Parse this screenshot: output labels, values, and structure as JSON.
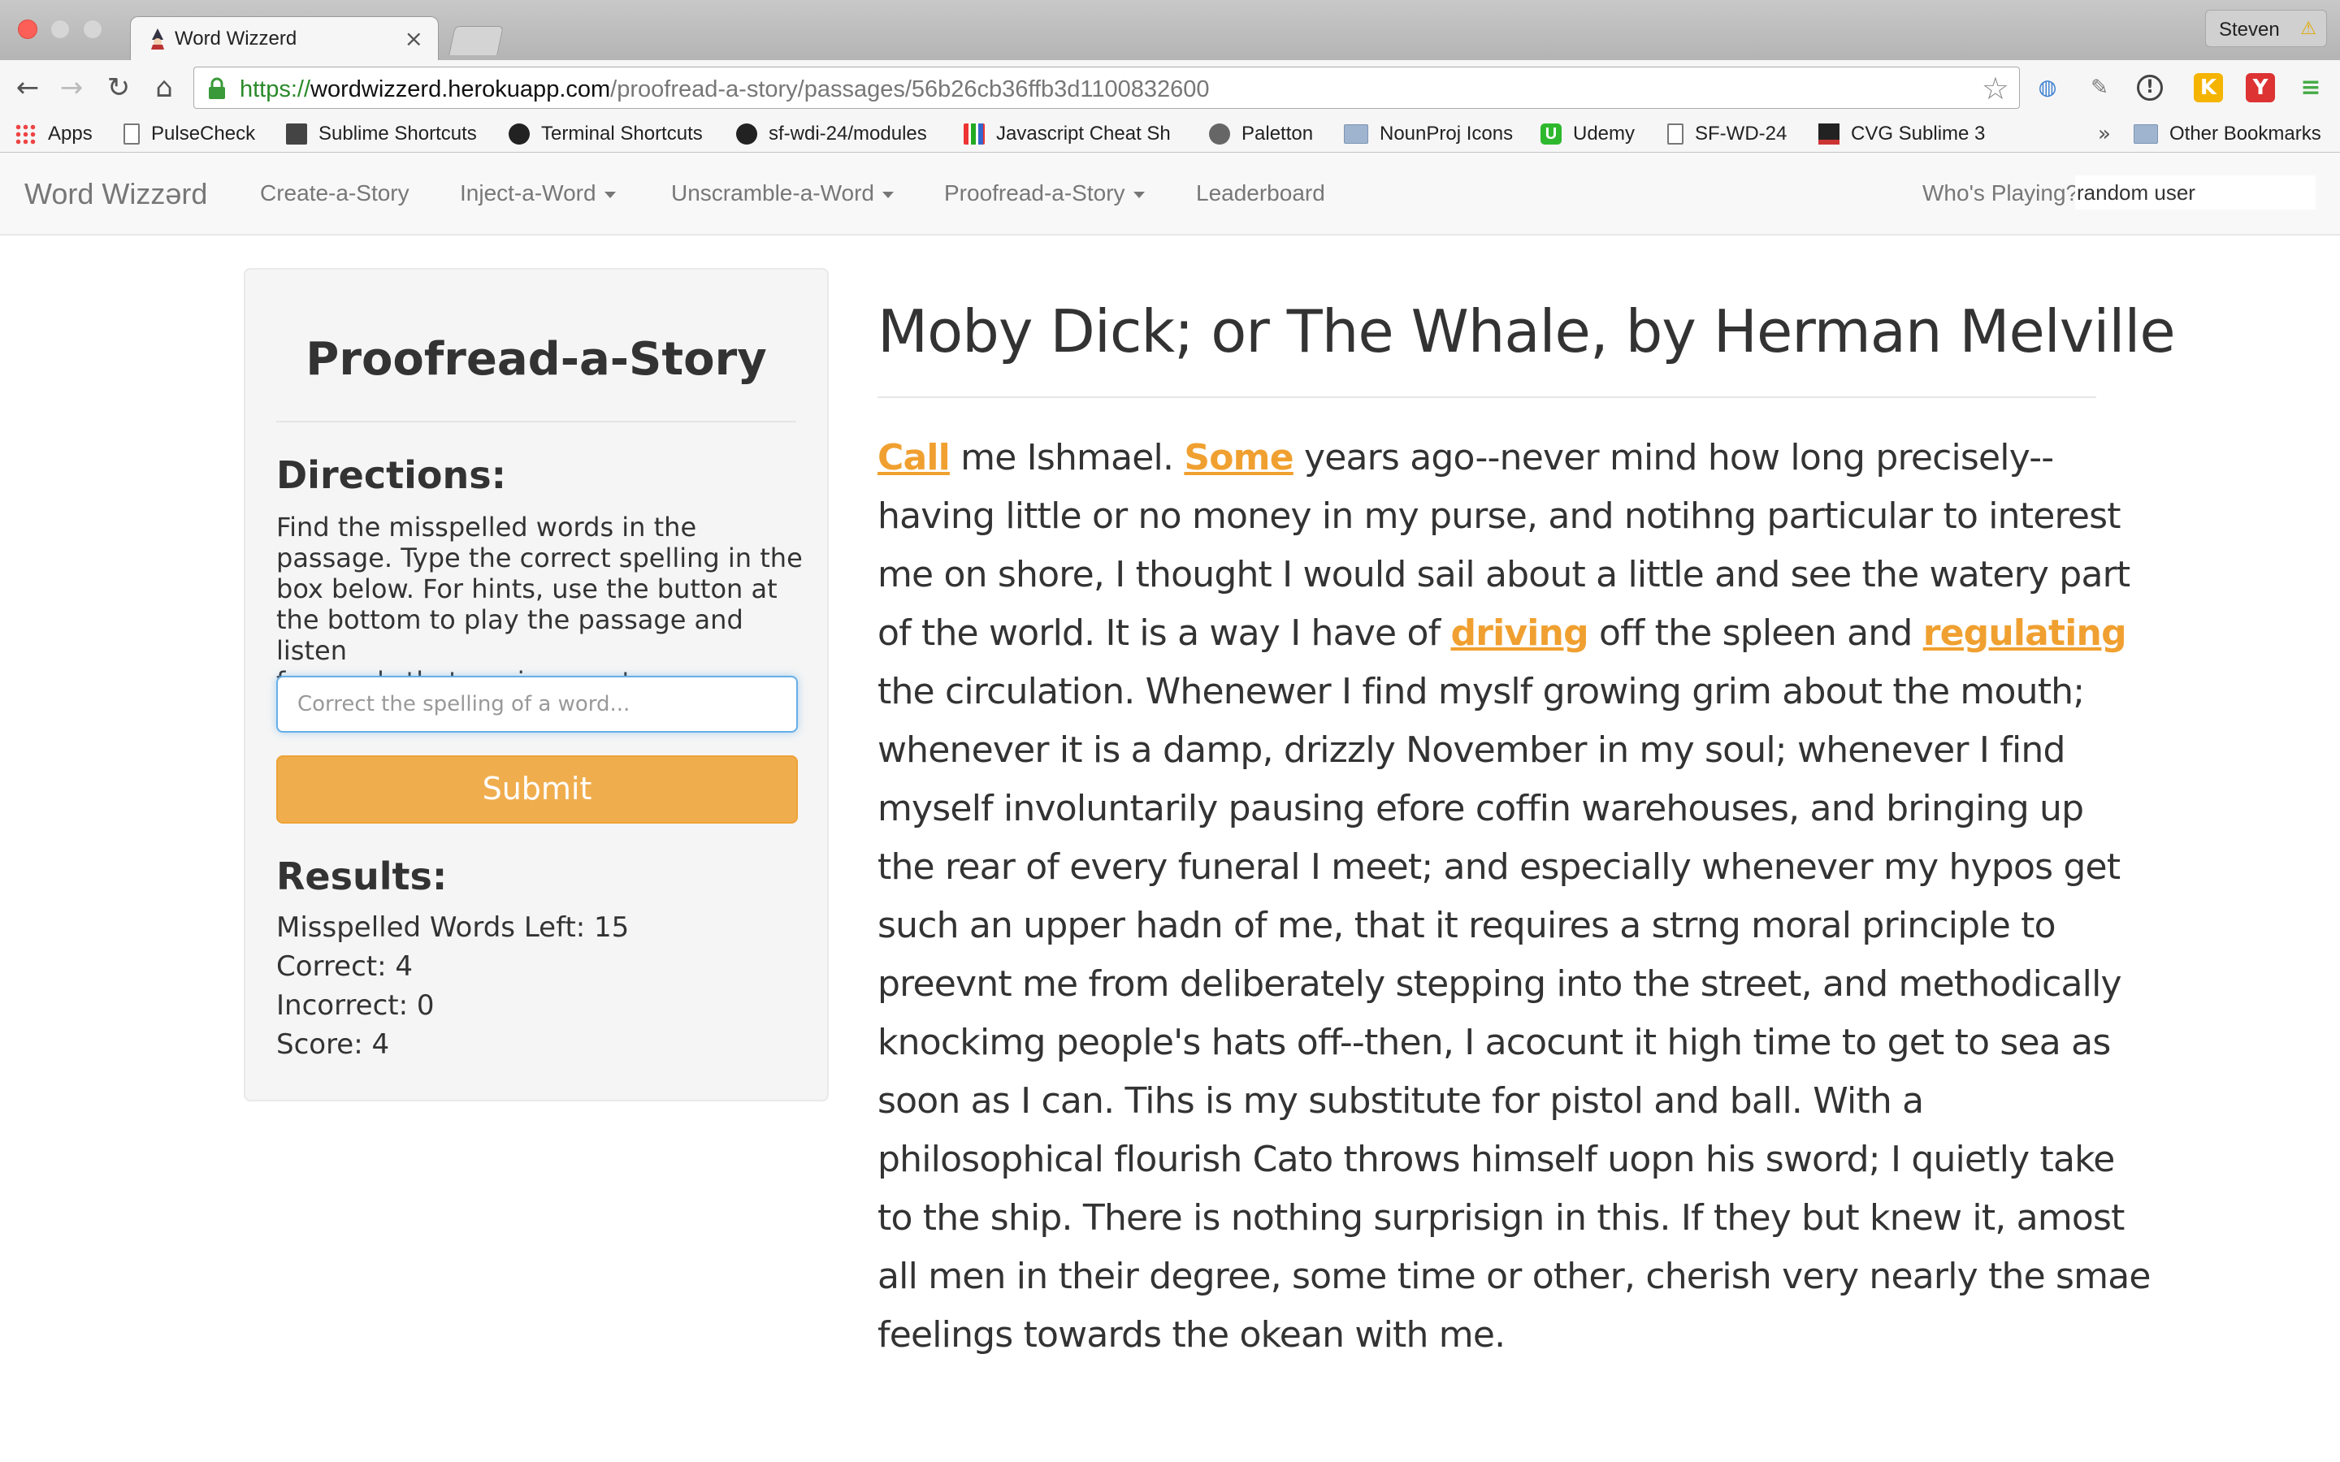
{
  "browser": {
    "tab_title": "Word Wizzerd",
    "profile_name": "Steven",
    "url_scheme": "https://",
    "url_host": "wordwizzerd.herokuapp.com",
    "url_path": "/proofread-a-story/passages/56b26cb36ffb3d1100832600",
    "bookmarks": {
      "b0": "Apps",
      "b1": "PulseCheck",
      "b2": "Sublime Shortcuts",
      "b3": "Terminal Shortcuts",
      "b4": "sf-wdi-24/modules",
      "b5": "Javascript Cheat Sh",
      "b6": "Paletton",
      "b7": "NounProj Icons",
      "b8": "Udemy",
      "b9": "SF-WD-24",
      "b10": "CVG Sublime 3",
      "other": "Other Bookmarks"
    }
  },
  "navbar": {
    "brand": "Word Wizzərd",
    "links": {
      "create": "Create-a-Story",
      "inject": "Inject-a-Word",
      "unscramble": "Unscramble-a-Word",
      "proofread": "Proofread-a-Story",
      "leaderboard": "Leaderboard"
    },
    "who_label": "Who's Playing?",
    "who_value": "random user"
  },
  "panel": {
    "title": "Proofread-a-Story",
    "directions_title": "Directions:",
    "directions_lines": {
      "l0": "Find the misspelled words in the",
      "l1": "passage. Type the correct spelling in the",
      "l2": "box below. For hints, use the button at",
      "l3": "the bottom to play the passage and listen",
      "l4": "for words that are incorrect."
    },
    "input_placeholder": "Correct the spelling of a word...",
    "submit_label": "Submit",
    "results_title": "Results:",
    "results": {
      "left": "Misspelled Words Left: 15",
      "correct": "Correct: 4",
      "incorrect": "Incorrect: 0",
      "score": "Score: 4"
    }
  },
  "story": {
    "title": "Moby Dick; or The Whale, by Herman Melville",
    "line0": {
      "w0": "Call",
      "t0": " me Ishmael. ",
      "w1": "Some",
      "t1": " years ago--never mind how long precisely--"
    },
    "line1": "having little or no money in my purse, and notihng particular to interest",
    "line2": "me on shore, I thought I would sail about a little and see the watery part",
    "line3": {
      "t0": "of the world. It is a way I have of ",
      "w0": "driving",
      "t1": " off the spleen and ",
      "w1": "regulating"
    },
    "line4": "the circulation. Whenewer I find myslf growing grim about the mouth;",
    "line5": "whenever it is a damp, drizzly November in my soul; whenever I find",
    "line6": "myself involuntarily pausing efore coffin warehouses, and bringing up",
    "line7": "the rear of every funeral I meet; and especially whenever my hypos get",
    "line8": "such an upper hadn of me, that it requires a strng moral principle to",
    "line9": "preevnt me from deliberately stepping into the street, and methodically",
    "line10": "knockimg people's hats off--then, I acocunt it high time to get to sea as",
    "line11": "soon as I can. Tihs is my substitute for pistol and ball. With a",
    "line12": "philosophical flourish Cato throws himself uopn his sword; I quietly take",
    "line13": "to the ship. There is nothing surprisign in this. If they but knew it, amost",
    "line14": "all men in their degree, some time or other, cherish very nearly the smae",
    "line15": "feelings towards the okean with me."
  },
  "colors": {
    "accent": "#f0ad4e",
    "highlight": "#f0a030",
    "focus": "#66afe9"
  }
}
